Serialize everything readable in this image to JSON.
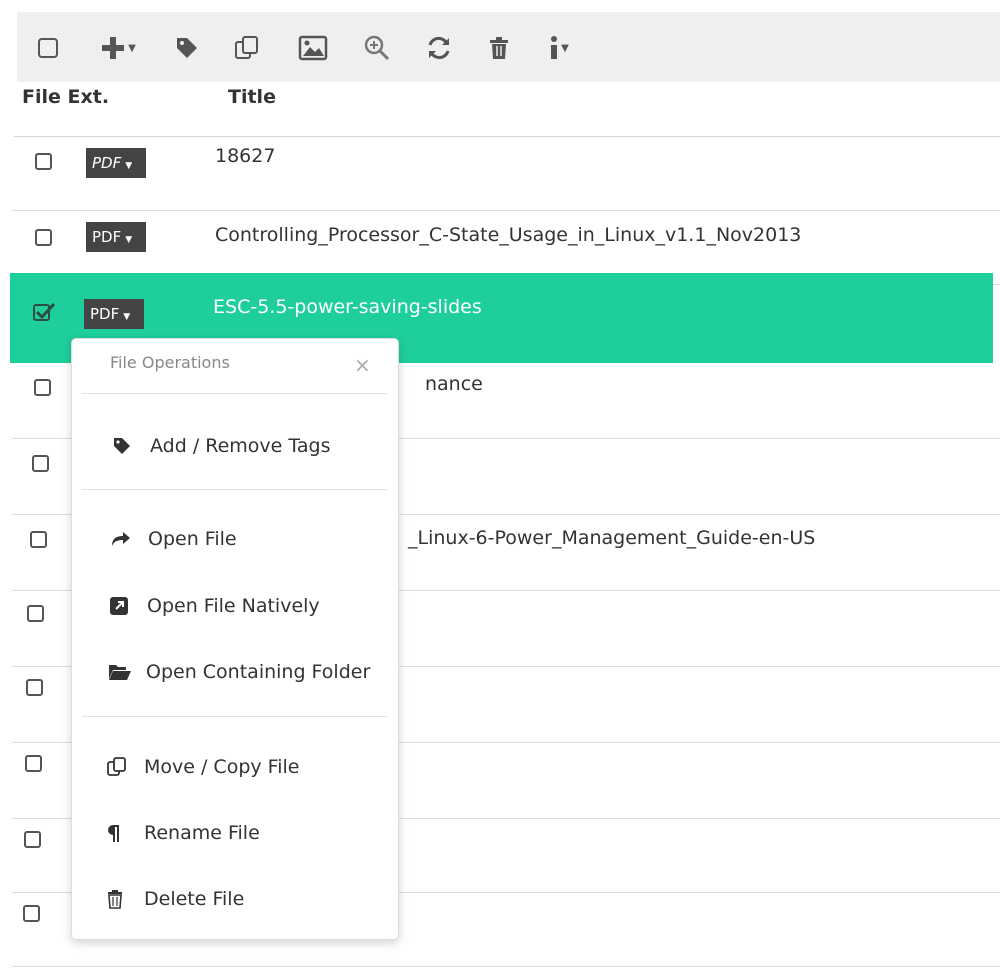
{
  "toolbar": {
    "icons": [
      "select-all-checkbox-icon",
      "add-icon",
      "tag-icon",
      "copy-icon",
      "image-icon",
      "zoom-icon",
      "refresh-icon",
      "trash-icon",
      "more-options-icon"
    ]
  },
  "table": {
    "headers": {
      "file_ext": "File Ext.",
      "title": "Title"
    },
    "rows": [
      {
        "ext": "PDF",
        "title": "18627",
        "checked": false
      },
      {
        "ext": "PDF",
        "title": "Controlling_Processor_C-State_Usage_in_Linux_v1.1_Nov2013",
        "checked": false
      },
      {
        "ext": "PDF",
        "title": "ESC-5.5-power-saving-slides",
        "checked": true
      },
      {
        "ext": "",
        "title": "nance",
        "checked": false
      },
      {
        "ext": "",
        "title": "",
        "checked": false
      },
      {
        "ext": "",
        "title": "_Linux-6-Power_Management_Guide-en-US",
        "checked": false
      },
      {
        "ext": "",
        "title": "",
        "checked": false
      },
      {
        "ext": "",
        "title": "",
        "checked": false
      },
      {
        "ext": "",
        "title": "",
        "checked": false
      },
      {
        "ext": "",
        "title": "",
        "checked": false
      },
      {
        "ext": "",
        "title": "",
        "checked": false
      }
    ]
  },
  "menu": {
    "title": "File Operations",
    "close": "×",
    "items": [
      {
        "label": "Add / Remove Tags",
        "icon": "tag-icon"
      },
      {
        "label": "Open File",
        "icon": "share-arrow-icon"
      },
      {
        "label": "Open File Natively",
        "icon": "external-link-icon"
      },
      {
        "label": "Open Containing Folder",
        "icon": "folder-open-icon"
      },
      {
        "label": "Move / Copy File",
        "icon": "copy-icon"
      },
      {
        "label": "Rename File",
        "icon": "paragraph-icon"
      },
      {
        "label": "Delete File",
        "icon": "trash-icon"
      }
    ]
  },
  "colors": {
    "selected_row": "#1ecf9d",
    "badge": "#444444",
    "toolbar_bg": "#efefef"
  }
}
